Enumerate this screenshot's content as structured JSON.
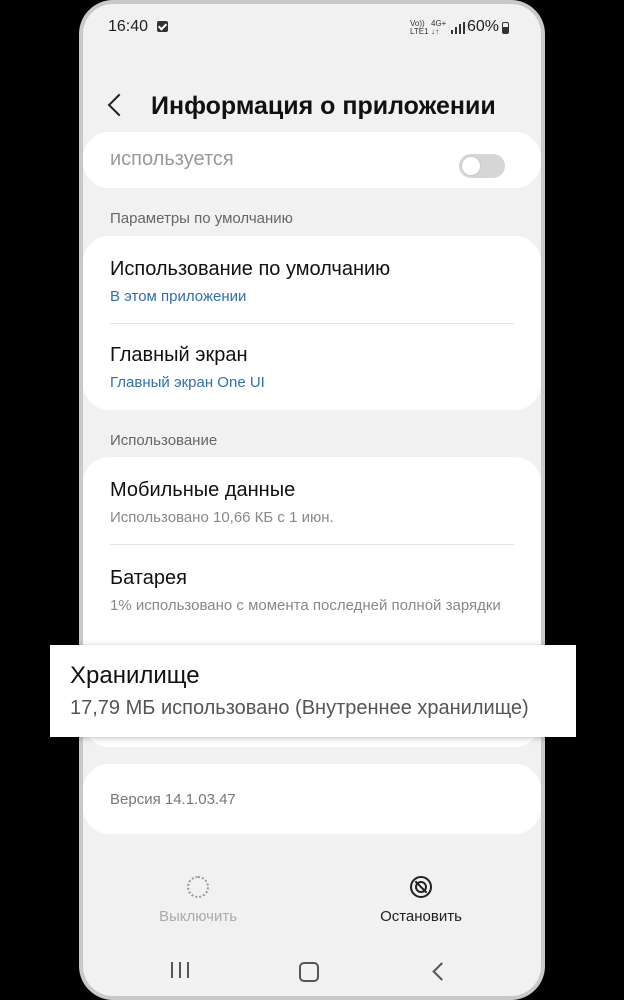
{
  "status_bar": {
    "time": "16:40",
    "volte_top": "Vo))",
    "volte_bottom": "LTE1",
    "network_top": "4G+",
    "network_bottom": "↓↑",
    "battery": "60%"
  },
  "header": {
    "title": "Информация о приложении"
  },
  "top_card": {
    "partial_text": "используется",
    "toggle_on": false
  },
  "defaults_section": {
    "label": "Параметры по умолчанию",
    "items": [
      {
        "title": "Использование по умолчанию",
        "subtitle": "В этом приложении"
      },
      {
        "title": "Главный экран",
        "subtitle": "Главный экран One UI"
      }
    ]
  },
  "usage_section": {
    "label": "Использование",
    "items": [
      {
        "title": "Мобильные данные",
        "subtitle": "Использовано 10,66 КБ с 1 июн."
      },
      {
        "title": "Батарея",
        "subtitle": "1% использовано с момента последней полной зарядки"
      }
    ]
  },
  "storage_highlight": {
    "title": "Хранилище",
    "subtitle": "17,79 МБ использовано (Внутреннее хранилище)"
  },
  "version": {
    "text": "Версия 14.1.03.47"
  },
  "actions": {
    "disable_label": "Выключить",
    "stop_label": "Остановить"
  },
  "colors": {
    "link_blue": "#2f6fb0",
    "background": "#f1f1f1",
    "card": "#ffffff"
  }
}
